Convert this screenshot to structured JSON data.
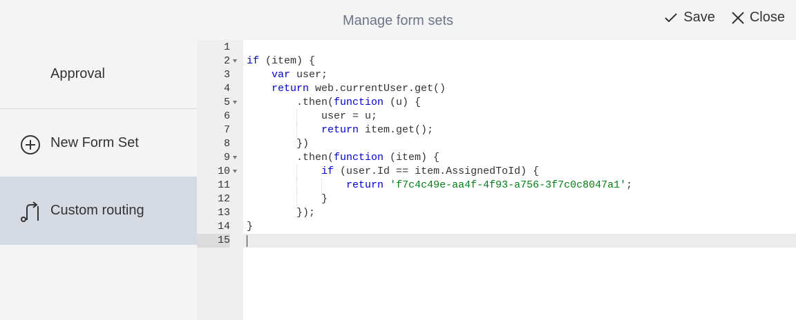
{
  "header": {
    "title": "Manage form sets",
    "save_label": "Save",
    "close_label": "Close"
  },
  "sidebar": {
    "items": [
      {
        "label": "Approval"
      },
      {
        "label": "New Form Set",
        "icon": "plus-circle-icon"
      },
      {
        "label": "Custom routing",
        "icon": "route-arrow-icon",
        "selected": true
      }
    ]
  },
  "editor": {
    "lines": [
      {
        "n": "1",
        "text": ""
      },
      {
        "n": "2",
        "text": "if (item) {"
      },
      {
        "n": "3",
        "text": "    var user;"
      },
      {
        "n": "4",
        "text": "    return web.currentUser.get()"
      },
      {
        "n": "5",
        "text": "        .then(function (u) {"
      },
      {
        "n": "6",
        "text": "            user = u;"
      },
      {
        "n": "7",
        "text": "            return item.get();"
      },
      {
        "n": "8",
        "text": "        })"
      },
      {
        "n": "9",
        "text": "        .then(function (item) {"
      },
      {
        "n": "10",
        "text": "            if (user.Id == item.AssignedToId) {"
      },
      {
        "n": "11",
        "text": "                return 'f7c4c49e-aa4f-4f93-a756-3f7c0c8047a1';"
      },
      {
        "n": "12",
        "text": "            }"
      },
      {
        "n": "13",
        "text": "        });"
      },
      {
        "n": "14",
        "text": "}"
      },
      {
        "n": "15",
        "text": ""
      }
    ],
    "folded_lines": [
      "2",
      "5",
      "9",
      "10"
    ],
    "active_line": "15"
  },
  "colors": {
    "accent_selected": "#d6dae2",
    "keyword": "#0000cd",
    "string": "#067d17",
    "title": "#6b7588"
  }
}
